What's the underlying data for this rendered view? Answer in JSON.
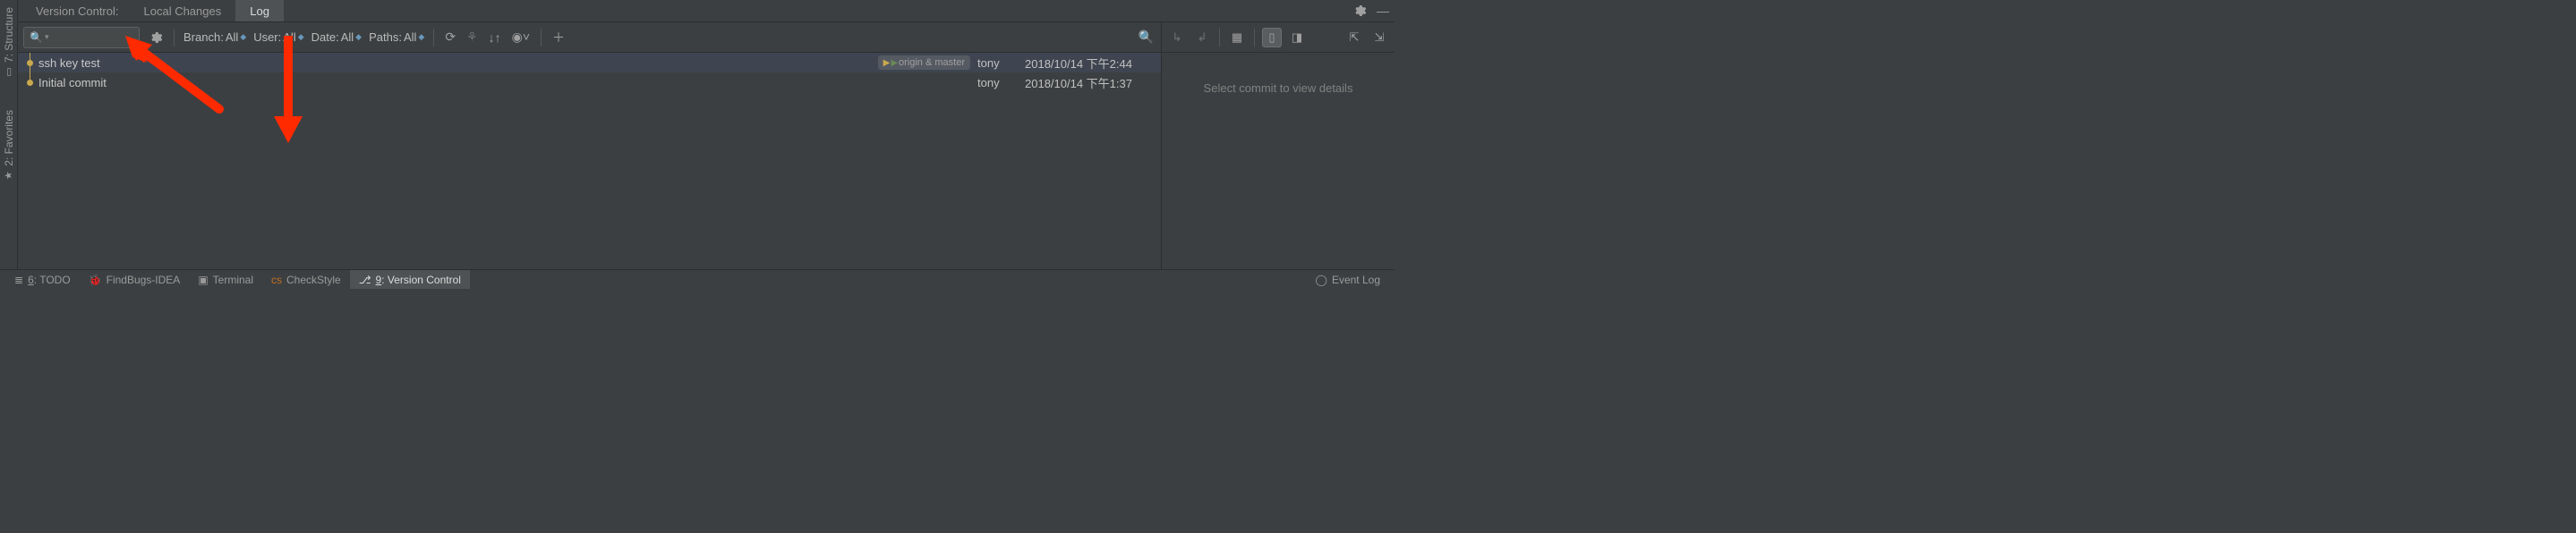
{
  "sidebar": {
    "structure": {
      "label": "7: Structure"
    },
    "favorites": {
      "label": "2: Favorites"
    }
  },
  "version_control": {
    "title": "Version Control:",
    "tabs": {
      "local_changes": "Local Changes",
      "log": "Log"
    }
  },
  "filters": {
    "branch_label": "Branch:",
    "branch_value": "All",
    "user_label": "User:",
    "user_value": "All",
    "date_label": "Date:",
    "date_value": "All",
    "paths_label": "Paths:",
    "paths_value": "All",
    "search_hint": "Q"
  },
  "commits": [
    {
      "message": "ssh key test",
      "branches": "origin & master",
      "author": "tony",
      "date": "2018/10/14 下午2:44"
    },
    {
      "message": "Initial commit",
      "branches": "",
      "author": "tony",
      "date": "2018/10/14 下午1:37"
    }
  ],
  "details": {
    "placeholder": "Select commit to view details"
  },
  "bottom_tabs": {
    "todo": "6: TODO",
    "findbugs": "FindBugs-IDEA",
    "terminal": "Terminal",
    "checkstyle": "CheckStyle",
    "version_control": "9: Version Control",
    "event_log": "Event Log"
  }
}
